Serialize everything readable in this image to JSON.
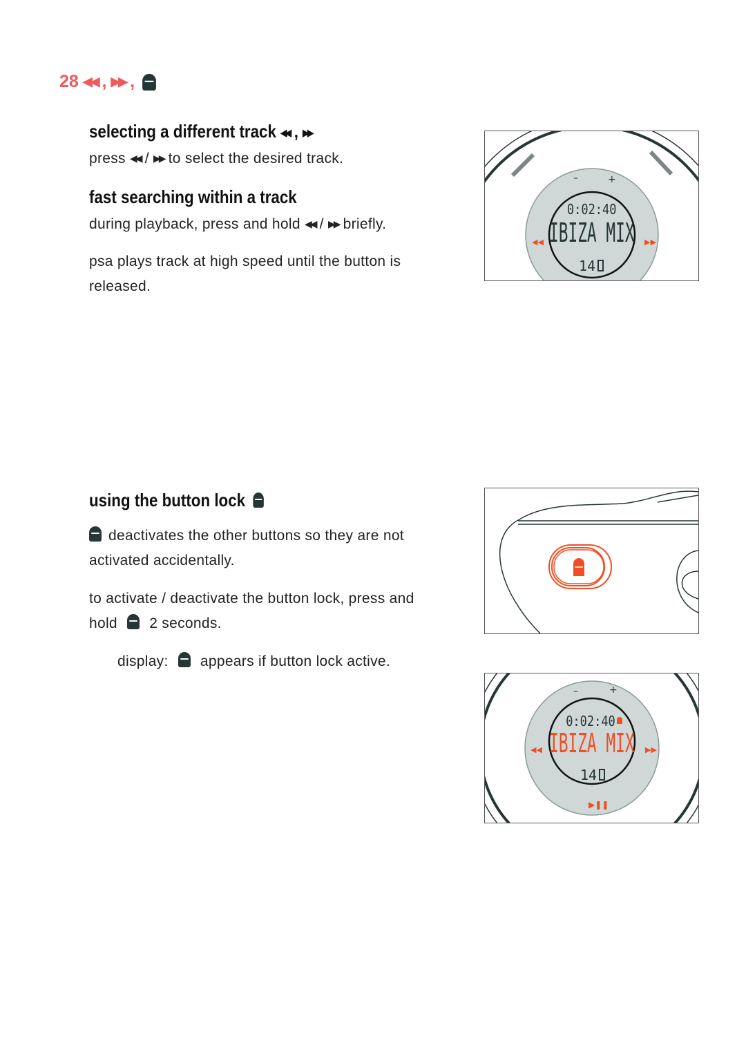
{
  "page": {
    "number": "28",
    "header_icons": [
      "rewind-icon",
      "fast-forward-icon",
      "lock-icon"
    ]
  },
  "sections": {
    "selecting": {
      "title": "selecting a different track",
      "body_prefix": "press",
      "body_suffix": "to select the desired track."
    },
    "fast_search": {
      "title": "fast searching within a track",
      "body1_prefix": "during playback, press and hold",
      "body1_suffix": "briefly.",
      "body2_line1": "psa plays track at high speed until the button is",
      "body2_line2": "released."
    },
    "button_lock": {
      "title": "using the button lock",
      "para1_line1": "deactivates the other buttons so they are not",
      "para1_line2": "activated accidentally.",
      "para2_line1": "to activate / deactivate the button lock, press and",
      "para2_line2_prefix": "hold",
      "para2_line2_suffix": "2 seconds.",
      "para3_prefix": "display:",
      "para3_suffix": "appears if button lock active."
    }
  },
  "separators": {
    "comma": ",",
    "slash": "/"
  },
  "figures": {
    "player_display": {
      "time": "0:02:40",
      "track": "IBIZA MIX",
      "track_number": "14",
      "vol_minus": "–",
      "vol_plus": "+"
    },
    "player_display_locked": {
      "time": "0:02:40",
      "track": "IBIZA MIX",
      "track_number": "14",
      "vol_minus": "–",
      "vol_plus": "+"
    }
  },
  "colors": {
    "accent": "#f05a5a",
    "device_orange": "#f04e23",
    "screen": "#cfd8d7",
    "ink": "#263535"
  }
}
